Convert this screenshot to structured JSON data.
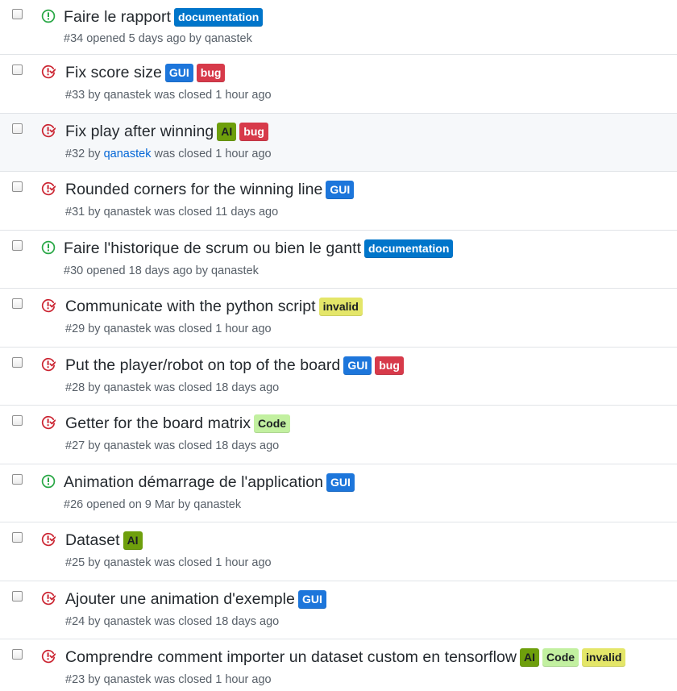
{
  "labels": {
    "documentation": {
      "text": "documentation",
      "bg": "#0075ca",
      "fg": "#ffffff"
    },
    "GUI": {
      "text": "GUI",
      "bg": "#1d76db",
      "fg": "#ffffff"
    },
    "bug": {
      "text": "bug",
      "bg": "#d73a4a",
      "fg": "#ffffff"
    },
    "AI": {
      "text": "AI",
      "bg": "#6e9f0c",
      "fg": "#1b1f23"
    },
    "invalid": {
      "text": "invalid",
      "bg": "#e4e669",
      "fg": "#1b1f23"
    },
    "Code": {
      "text": "Code",
      "bg": "#c2f0a0",
      "fg": "#1b1f23"
    }
  },
  "colors": {
    "open_icon": "#28a745",
    "closed_icon": "#cb2431"
  },
  "issues": [
    {
      "state": "open",
      "title": "Faire le rapport",
      "labels": [
        "documentation"
      ],
      "number": "#34",
      "status_text": "opened 5 days ago by",
      "author": "qanastek"
    },
    {
      "state": "closed",
      "title": "Fix score size",
      "labels": [
        "GUI",
        "bug"
      ],
      "number": "#33",
      "status_text": "by",
      "author": "qanastek",
      "closed_text": "was closed 1 hour ago"
    },
    {
      "state": "closed",
      "title": "Fix play after winning",
      "labels": [
        "AI",
        "bug"
      ],
      "number": "#32",
      "status_text": "by",
      "author": "qanastek",
      "closed_text": "was closed 1 hour ago",
      "hover": true
    },
    {
      "state": "closed",
      "title": "Rounded corners for the winning line",
      "labels": [
        "GUI"
      ],
      "number": "#31",
      "status_text": "by",
      "author": "qanastek",
      "closed_text": "was closed 11 days ago"
    },
    {
      "state": "open",
      "title": "Faire l'historique de scrum ou bien le gantt",
      "labels": [
        "documentation"
      ],
      "number": "#30",
      "status_text": "opened 18 days ago by",
      "author": "qanastek"
    },
    {
      "state": "closed",
      "title": "Communicate with the python script",
      "labels": [
        "invalid"
      ],
      "number": "#29",
      "status_text": "by",
      "author": "qanastek",
      "closed_text": "was closed 1 hour ago"
    },
    {
      "state": "closed",
      "title": "Put the player/robot on top of the board",
      "labels": [
        "GUI",
        "bug"
      ],
      "number": "#28",
      "status_text": "by",
      "author": "qanastek",
      "closed_text": "was closed 18 days ago"
    },
    {
      "state": "closed",
      "title": "Getter for the board matrix",
      "labels": [
        "Code"
      ],
      "number": "#27",
      "status_text": "by",
      "author": "qanastek",
      "closed_text": "was closed 18 days ago"
    },
    {
      "state": "open",
      "title": "Animation démarrage de l'application",
      "labels": [
        "GUI"
      ],
      "number": "#26",
      "status_text": "opened on 9 Mar by",
      "author": "qanastek"
    },
    {
      "state": "closed",
      "title": "Dataset",
      "labels": [
        "AI"
      ],
      "number": "#25",
      "status_text": "by",
      "author": "qanastek",
      "closed_text": "was closed 1 hour ago"
    },
    {
      "state": "closed",
      "title": "Ajouter une animation d'exemple",
      "labels": [
        "GUI"
      ],
      "number": "#24",
      "status_text": "by",
      "author": "qanastek",
      "closed_text": "was closed 18 days ago"
    },
    {
      "state": "closed",
      "title": "Comprendre comment importer un dataset custom en tensorflow",
      "labels": [
        "AI",
        "Code",
        "invalid"
      ],
      "number": "#23",
      "status_text": "by",
      "author": "qanastek",
      "closed_text": "was closed 1 hour ago"
    }
  ]
}
